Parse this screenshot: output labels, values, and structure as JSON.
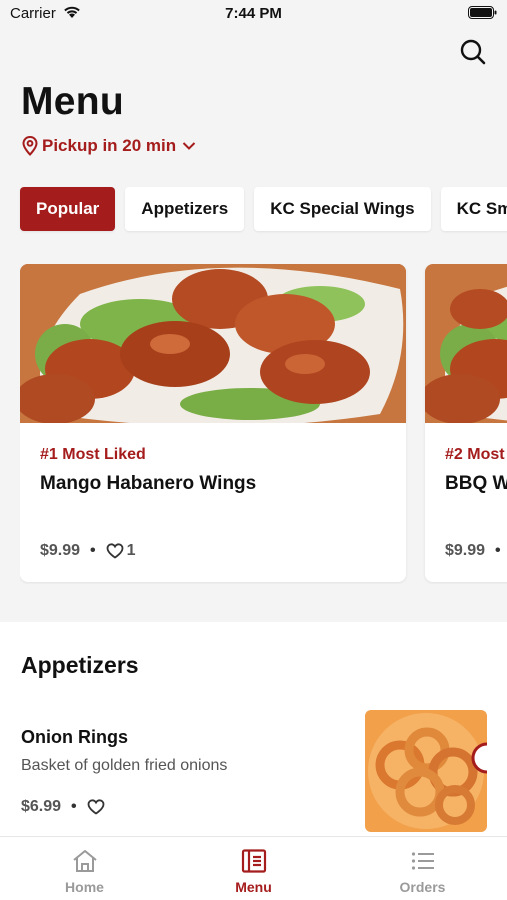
{
  "status_bar": {
    "carrier": "Carrier",
    "time": "7:44 PM"
  },
  "page": {
    "title": "Menu",
    "pickup_label": "Pickup in 20 min"
  },
  "tabs": [
    {
      "label": "Popular",
      "active": true
    },
    {
      "label": "Appetizers",
      "active": false
    },
    {
      "label": "KC Special Wings",
      "active": false
    },
    {
      "label": "KC Sm",
      "active": false
    }
  ],
  "featured": [
    {
      "rank": "#1 Most Liked",
      "name": "Mango Habanero Wings",
      "price": "$9.99",
      "likes": "1"
    },
    {
      "rank": "#2 Most",
      "name": "BBQ W",
      "price": "$9.99",
      "likes": ""
    }
  ],
  "appetizers": {
    "title": "Appetizers",
    "items": [
      {
        "name": "Onion Rings",
        "description": "Basket of golden fried onions",
        "price": "$6.99"
      }
    ]
  },
  "bottom_nav": [
    {
      "label": "Home",
      "icon": "home-icon",
      "active": false
    },
    {
      "label": "Menu",
      "icon": "menu-book-icon",
      "active": true
    },
    {
      "label": "Orders",
      "icon": "list-icon",
      "active": false
    }
  ],
  "colors": {
    "accent": "#a51c1c",
    "background": "#f4f4f4",
    "muted": "#9a9a9a"
  }
}
